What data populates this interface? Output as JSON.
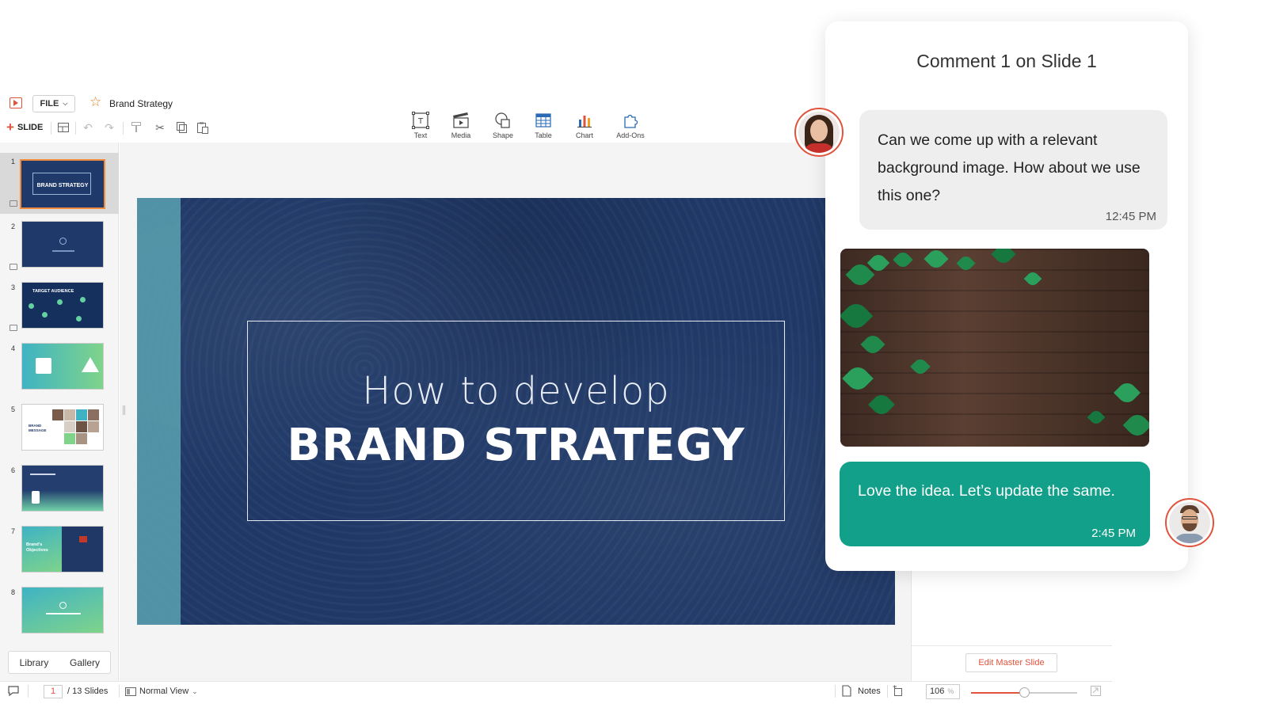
{
  "menubar": {
    "file_label": "FILE",
    "doc_title": "Brand Strategy"
  },
  "toolbar": {
    "add_slide_label": "SLIDE",
    "insert_items": [
      {
        "label": "Text",
        "icon": "text-box-icon"
      },
      {
        "label": "Media",
        "icon": "clapper-icon"
      },
      {
        "label": "Shape",
        "icon": "shape-icon"
      },
      {
        "label": "Table",
        "icon": "table-icon"
      },
      {
        "label": "Chart",
        "icon": "bar-chart-icon"
      },
      {
        "label": "Add-Ons",
        "icon": "puzzle-icon"
      }
    ]
  },
  "thumbnails": {
    "slides": [
      {
        "num": "1",
        "title": "BRAND STRATEGY"
      },
      {
        "num": "2"
      },
      {
        "num": "3",
        "title": "TARGET AUDIENCE"
      },
      {
        "num": "4"
      },
      {
        "num": "5",
        "title": "BRAND MESSAGE"
      },
      {
        "num": "6"
      },
      {
        "num": "7",
        "title": "Brand's Objectives"
      },
      {
        "num": "8"
      }
    ],
    "library_label": "Library",
    "gallery_label": "Gallery"
  },
  "slide": {
    "line1": "How to develop",
    "line2": "BRAND STRATEGY"
  },
  "properties": {
    "edit_master_label": "Edit Master Slide"
  },
  "statusbar": {
    "current_page": "1",
    "total_slides": "/ 13 Slides",
    "view_mode": "Normal View",
    "notes_label": "Notes",
    "zoom_value": "106",
    "zoom_unit": "%",
    "zoom_slider_fraction": 0.5
  },
  "comment": {
    "title": "Comment 1 on Slide 1",
    "message1": "Can we come up with a relevant background image. How about we use this one?",
    "time1": "12:45 PM",
    "message2": "Love the idea. Let’s update the same.",
    "time2": "2:45 PM"
  },
  "colors": {
    "accent": "#e0533d",
    "slide_bg": "#1f3866",
    "reply_bubble": "#12a08a",
    "strip": "#5ba2b2"
  }
}
